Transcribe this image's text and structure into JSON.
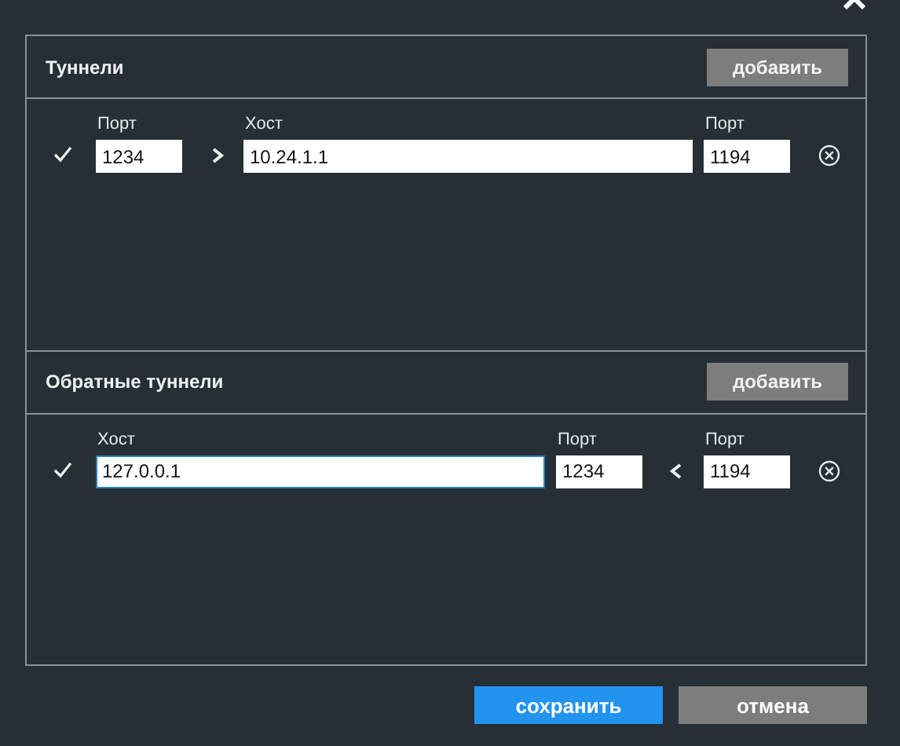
{
  "sections": [
    {
      "title": "Туннели",
      "add_button": "добавить",
      "rows": [
        {
          "checked": true,
          "items": [
            {
              "kind": "port",
              "label": "Порт",
              "value": "1234",
              "focused": false
            },
            {
              "kind": "arrow_right"
            },
            {
              "kind": "host",
              "label": "Хост",
              "value": "10.24.1.1",
              "focused": false
            },
            {
              "kind": "port",
              "label": "Порт",
              "value": "1194",
              "focused": false
            }
          ]
        }
      ]
    },
    {
      "title": "Обратные туннели",
      "add_button": "добавить",
      "rows": [
        {
          "checked": true,
          "items": [
            {
              "kind": "host",
              "label": "Хост",
              "value": "127.0.0.1",
              "focused": true
            },
            {
              "kind": "port",
              "label": "Порт",
              "value": "1234",
              "focused": false
            },
            {
              "kind": "arrow_left"
            },
            {
              "kind": "port",
              "label": "Порт",
              "value": "1194",
              "focused": false
            }
          ]
        }
      ]
    }
  ],
  "buttons": [
    {
      "label": "сохранить",
      "kind": "primary"
    },
    {
      "label": "отмена",
      "kind": "secondary"
    }
  ]
}
